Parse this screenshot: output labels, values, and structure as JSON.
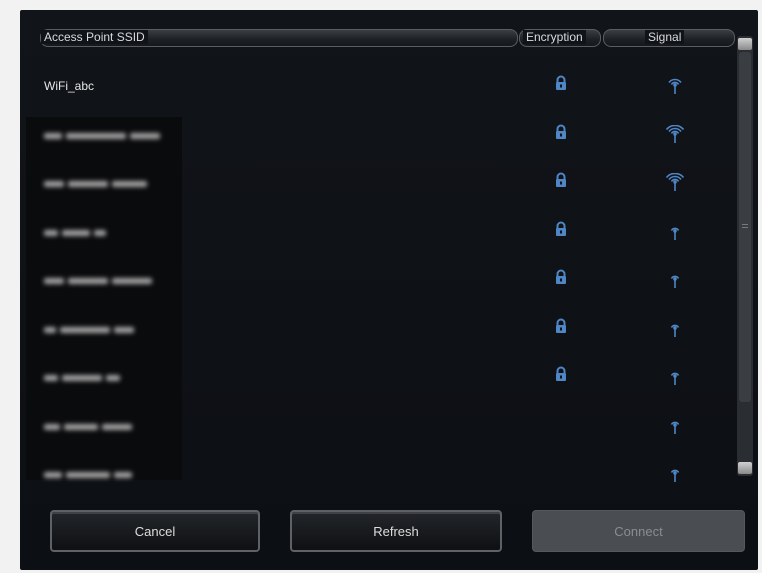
{
  "header": {
    "ssid_label": "Access Point SSID",
    "encryption_label": "Encryption",
    "signal_label": "Signal"
  },
  "networks": [
    {
      "ssid": "WiFi_abc",
      "encrypted": true,
      "signal": 2
    },
    {
      "ssid": "",
      "encrypted": true,
      "signal": 3
    },
    {
      "ssid": "",
      "encrypted": true,
      "signal": 3
    },
    {
      "ssid": "",
      "encrypted": true,
      "signal": 1
    },
    {
      "ssid": "",
      "encrypted": true,
      "signal": 1
    },
    {
      "ssid": "",
      "encrypted": true,
      "signal": 1
    },
    {
      "ssid": "",
      "encrypted": true,
      "signal": 1
    },
    {
      "ssid": "",
      "encrypted": false,
      "signal": 1
    },
    {
      "ssid": "",
      "encrypted": false,
      "signal": 1
    }
  ],
  "buttons": {
    "cancel": "Cancel",
    "refresh": "Refresh",
    "connect": "Connect"
  },
  "colors": {
    "icon_blue": "#4f86c6",
    "panel_bg": "#0e1116"
  }
}
